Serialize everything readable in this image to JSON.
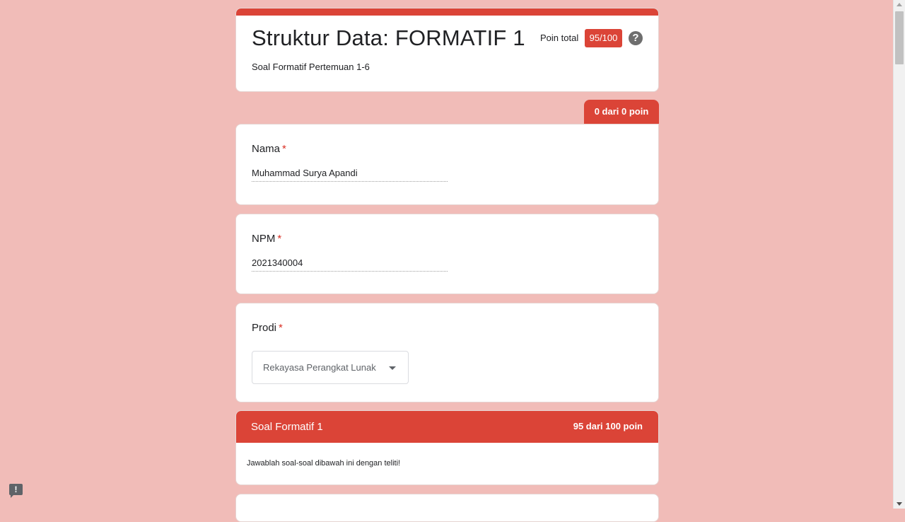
{
  "header": {
    "title": "Struktur Data: FORMATIF 1",
    "description": "Soal Formatif Pertemuan 1-6",
    "total_label": "Poin total",
    "total_score": "95/100",
    "help_glyph": "?"
  },
  "score_tab": "0 dari 0 poin",
  "questions": [
    {
      "label": "Nama",
      "required_mark": "*",
      "answer": "Muhammad Surya Apandi"
    },
    {
      "label": "NPM",
      "required_mark": "*",
      "answer": "2021340004"
    },
    {
      "label": "Prodi",
      "required_mark": "*",
      "selected": "Rekayasa Perangkat Lunak"
    }
  ],
  "section": {
    "title": "Soal Formatif 1",
    "score": "95 dari 100 poin",
    "description": "Jawablah soal-soal dibawah ini dengan teliti!"
  },
  "feedback_glyph": "!",
  "colors": {
    "background": "#f1bcb8",
    "accent": "#db4437",
    "required": "#d93025"
  },
  "icons": [
    "help-icon",
    "dropdown-arrow-icon",
    "feedback-icon"
  ]
}
